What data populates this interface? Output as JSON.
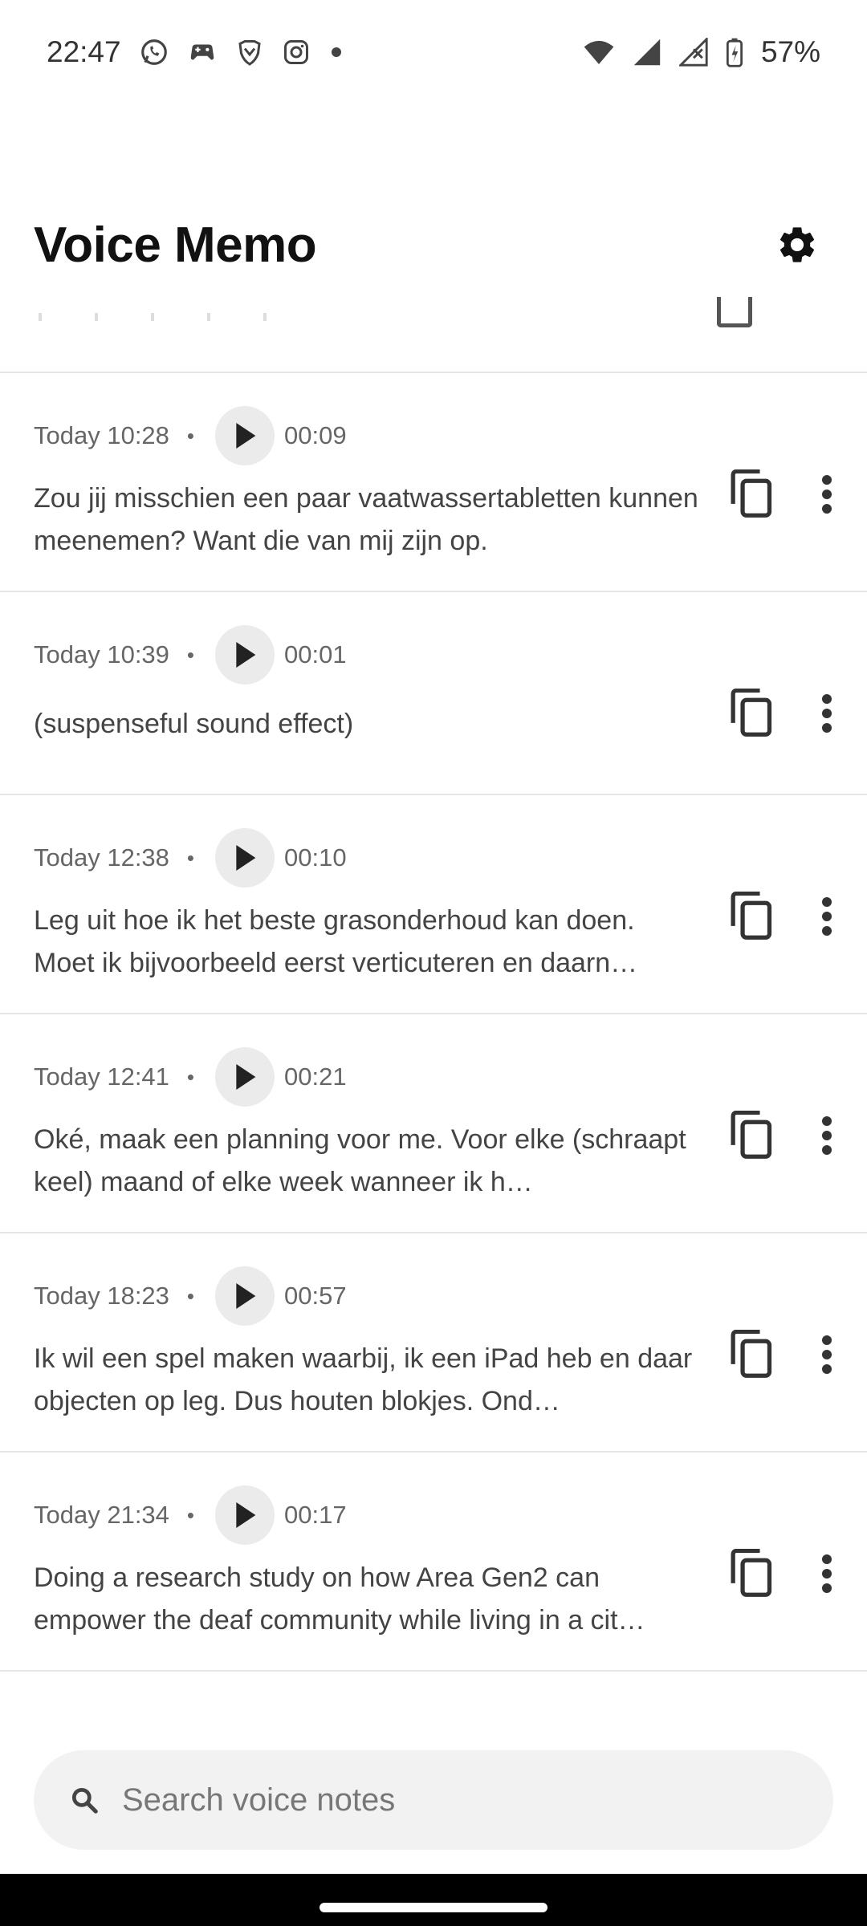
{
  "status_bar": {
    "time": "22:47",
    "battery": "57%",
    "notification_icons": [
      "whatsapp-icon",
      "game-controller-icon",
      "brave-icon",
      "instagram-icon",
      "more-dot-icon"
    ],
    "system_icons": [
      "wifi-icon",
      "signal-icon",
      "signal-no-data-icon",
      "battery-charging-icon"
    ]
  },
  "header": {
    "title": "Voice Memo",
    "settings_icon": "gear-icon"
  },
  "memos": [
    {
      "time": "Today 10:28",
      "duration": "00:09",
      "text": "Zou jij misschien een paar vaatwassertabletten kunnen meenemen? Want die van mij zijn op."
    },
    {
      "time": "Today 10:39",
      "duration": "00:01",
      "text": "(suspenseful sound effect)"
    },
    {
      "time": "Today 12:38",
      "duration": "00:10",
      "text": "Leg uit hoe ik het beste grasonderhoud kan doen. Moet ik bijvoorbeeld eerst verticuteren en daarn…"
    },
    {
      "time": "Today 12:41",
      "duration": "00:21",
      "text": "Oké, maak een planning voor me. Voor elke (schraapt keel) maand of elke week wanneer ik h…"
    },
    {
      "time": "Today 18:23",
      "duration": "00:57",
      "text": "Ik wil een spel maken waarbij, ik een iPad heb en daar objecten op leg. Dus houten blokjes. Ond…"
    },
    {
      "time": "Today 21:34",
      "duration": "00:17",
      "text": "Doing a research study on how Area Gen2 can empower the deaf community while living in a cit…"
    }
  ],
  "search": {
    "placeholder": "Search voice notes",
    "value": ""
  }
}
